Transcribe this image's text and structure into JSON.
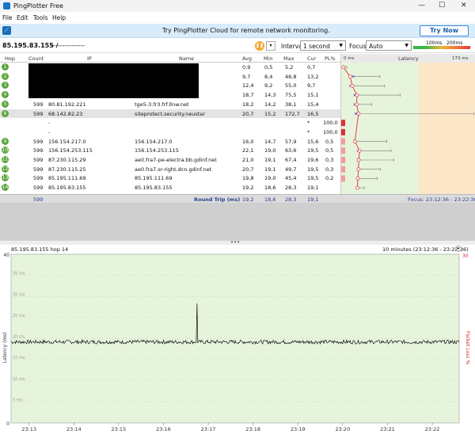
{
  "window": {
    "title": "PingPlotter Free",
    "min": "—",
    "max": "☐",
    "close": "✕"
  },
  "menu": [
    "File",
    "Edit",
    "Tools",
    "Help"
  ],
  "banner": {
    "icon": "pingplotter-icon",
    "text": "Try PingPlotter Cloud for remote network monitoring.",
    "button": "Try Now"
  },
  "toolbar": {
    "target": "85.195.83.155 /",
    "target_name": "---------------",
    "interval_label": "Interval",
    "interval_value": "1 second",
    "focus_label": "Focus",
    "focus_value": "Auto",
    "scale_100": "100ms",
    "scale_200": "200ms"
  },
  "columns": {
    "hop": "Hop",
    "count": "Count",
    "ip": "IP",
    "name": "Name",
    "avg": "Avg",
    "min": "Min",
    "max": "Max",
    "cur": "Cur",
    "pl": "PL%",
    "latency": "Latency",
    "lat0": "0 ms",
    "latmax": "173 ms"
  },
  "hops": [
    {
      "hop": "1",
      "count": "",
      "ip": "",
      "name": "",
      "avg": "0,9",
      "min": "0,5",
      "max": "5,2",
      "cur": "0,7",
      "pl": ""
    },
    {
      "hop": "2",
      "count": "",
      "ip": "",
      "name": "",
      "avg": "9,7",
      "min": "8,4",
      "max": "48,8",
      "cur": "13,2",
      "pl": ""
    },
    {
      "hop": "3",
      "count": "",
      "ip": "",
      "name": "",
      "avg": "12,4",
      "min": "9,2",
      "max": "55,0",
      "cur": "9,7",
      "pl": ""
    },
    {
      "hop": "4",
      "count": "",
      "ip": "",
      "name": "",
      "avg": "18,7",
      "min": "14,3",
      "max": "75,5",
      "cur": "15,1",
      "pl": ""
    },
    {
      "hop": "5",
      "count": "599",
      "ip": "80.81.192.221",
      "name": "tge5-3.fr3.frf.llnw.net",
      "avg": "18,2",
      "min": "14,2",
      "max": "38,1",
      "cur": "15,4",
      "pl": ""
    },
    {
      "hop": "6",
      "count": "599",
      "ip": "68.142.82.23",
      "name": "siteprotect.security.neustar",
      "avg": "20,7",
      "min": "15,2",
      "max": "172,7",
      "cur": "16,5",
      "pl": ""
    },
    {
      "hop": "7",
      "count": "",
      "ip": "-",
      "name": "",
      "avg": "",
      "min": "",
      "max": "",
      "cur": "*",
      "pl": "100,0"
    },
    {
      "hop": "8",
      "count": "",
      "ip": "-",
      "name": "",
      "avg": "",
      "min": "",
      "max": "",
      "cur": "*",
      "pl": "100,0"
    },
    {
      "hop": "9",
      "count": "599",
      "ip": "156.154.217.0",
      "name": "156.154.217.0",
      "avg": "16,0",
      "min": "14,7",
      "max": "57,9",
      "cur": "15,6",
      "pl": "0,5"
    },
    {
      "hop": "10",
      "count": "599",
      "ip": "156.154.253.115",
      "name": "156.154.253.115",
      "avg": "22,1",
      "min": "19,0",
      "max": "63,6",
      "cur": "19,5",
      "pl": "0,5"
    },
    {
      "hop": "11",
      "count": "599",
      "ip": "87.230.115.29",
      "name": "ae0.fra7-pe-electra.bb.gdinf.net",
      "avg": "21,0",
      "min": "19,1",
      "max": "67,4",
      "cur": "19,6",
      "pl": "0,3"
    },
    {
      "hop": "12",
      "count": "599",
      "ip": "87.230.115.25",
      "name": "ae0.fra7.sr-right.dcn.gdinf.net",
      "avg": "20,7",
      "min": "19,1",
      "max": "49,7",
      "cur": "19,5",
      "pl": "0,3"
    },
    {
      "hop": "13",
      "count": "599",
      "ip": "85.195.111.69",
      "name": "85.195.111.69",
      "avg": "19,8",
      "min": "19,0",
      "max": "45,4",
      "cur": "19,5",
      "pl": "0,2"
    },
    {
      "hop": "14",
      "count": "599",
      "ip": "85.195.83.155",
      "name": "85.195.83.155",
      "avg": "19,2",
      "min": "18,6",
      "max": "28,3",
      "cur": "19,1",
      "pl": ""
    }
  ],
  "summary": {
    "count": "599",
    "label": "Round Trip (ms)",
    "avg": "19,2",
    "min": "18,6",
    "max": "28,3",
    "cur": "19,1",
    "focus": "Focus: 23:12:36 - 23:22:36"
  },
  "graph": {
    "title": "85.195.83.155 hop 14",
    "range": "10 minutes (23:12:36 - 23:22:36)",
    "ylabel": "Latency (ms)",
    "y2label": "Packet Loss %",
    "y_ticks": [
      "40",
      "35 ms",
      "30 ms",
      "25 ms",
      "20 ms",
      "15 ms",
      "10 ms",
      "5 ms",
      "0"
    ],
    "y2_top": "30",
    "x_ticks": [
      "23:13",
      "23:14",
      "23:15",
      "23:16",
      "23:17",
      "23:18",
      "23:19",
      "23:20",
      "23:21",
      "23:22"
    ]
  },
  "chart_data": {
    "type": "line",
    "title": "85.195.83.155 hop 14",
    "xlabel": "",
    "ylabel": "Latency (ms)",
    "ylim": [
      0,
      40
    ],
    "y2label": "Packet Loss %",
    "y2lim": [
      0,
      30
    ],
    "x_start": "23:12:36",
    "x_end": "23:22:36",
    "baseline_ms": 19.2,
    "spike": {
      "time": "23:16:45",
      "value": 28.3
    },
    "categories": [
      "23:13",
      "23:14",
      "23:15",
      "23:16",
      "23:17",
      "23:18",
      "23:19",
      "23:20",
      "23:21",
      "23:22"
    ]
  }
}
